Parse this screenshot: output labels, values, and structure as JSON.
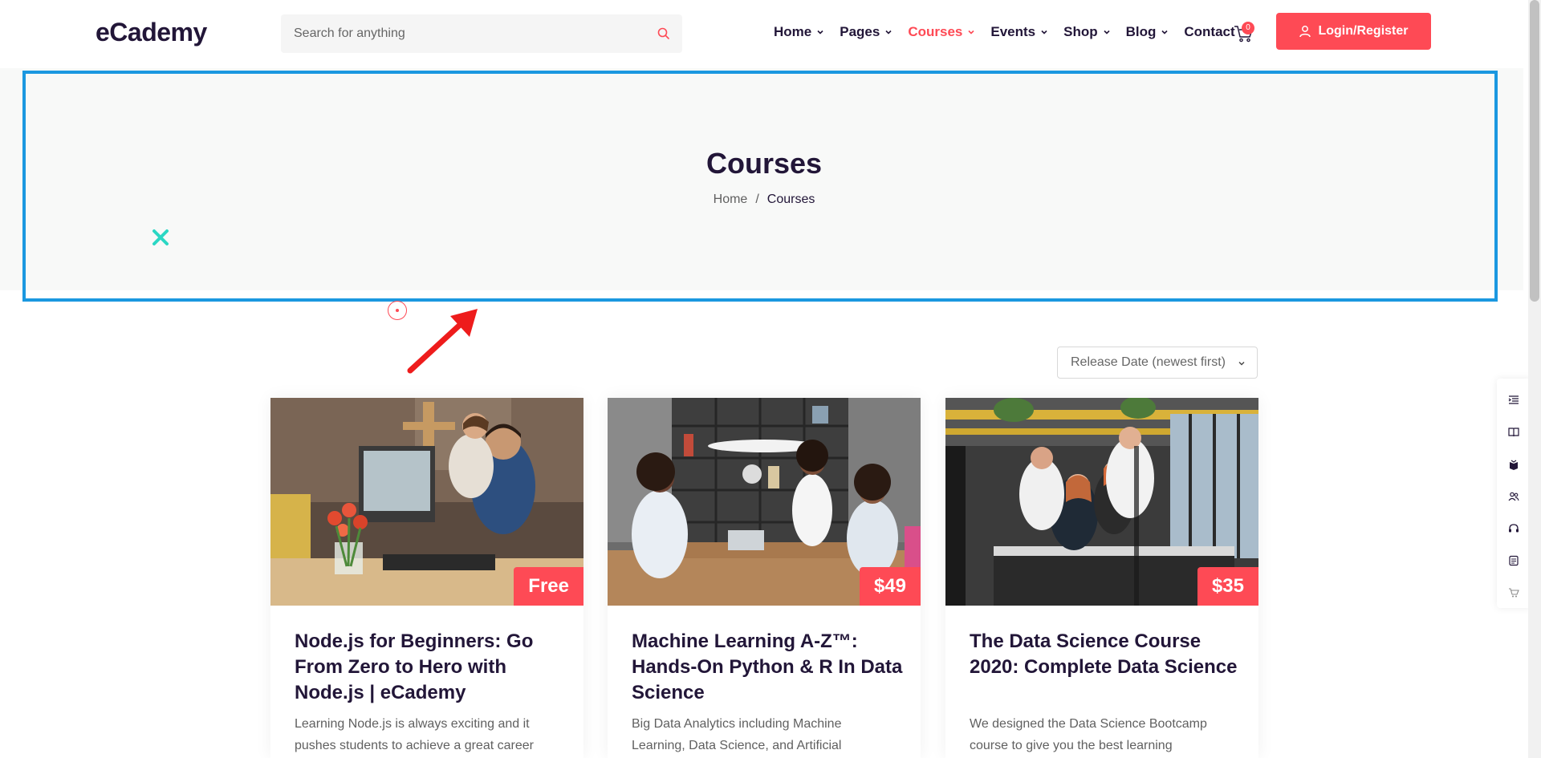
{
  "header": {
    "logo": "eCademy",
    "search_placeholder": "Search for anything",
    "nav": [
      {
        "label": "Home",
        "dropdown": true,
        "active": false
      },
      {
        "label": "Pages",
        "dropdown": true,
        "active": false
      },
      {
        "label": "Courses",
        "dropdown": true,
        "active": true
      },
      {
        "label": "Events",
        "dropdown": true,
        "active": false
      },
      {
        "label": "Shop",
        "dropdown": true,
        "active": false
      },
      {
        "label": "Blog",
        "dropdown": true,
        "active": false
      },
      {
        "label": "Contact",
        "dropdown": false,
        "active": false
      }
    ],
    "cart_count": "0",
    "login_label": "Login/Register"
  },
  "page_title": {
    "title": "Courses",
    "breadcrumb_home": "Home",
    "breadcrumb_sep": "/",
    "breadcrumb_current": "Courses"
  },
  "sort": {
    "selected": "Release Date (newest first)"
  },
  "courses": [
    {
      "price": "Free",
      "title": "Node.js for Beginners: Go From Zero to Hero with Node.js | eCademy",
      "description": "Learning Node.js is always exciting and it pushes students to achieve a great career"
    },
    {
      "price": "$49",
      "title": "Machine Learning A-Z™: Hands-On Python & R In Data Science",
      "description": "Big Data Analytics including Machine Learning, Data Science, and Artificial"
    },
    {
      "price": "$35",
      "title": "The Data Science Course 2020: Complete Data Science",
      "description": "We designed the Data Science Bootcamp course to give you the best learning"
    }
  ],
  "dock_icons": [
    "menu-list-icon",
    "book-open-icon",
    "book-icon",
    "users-icon",
    "headset-icon",
    "blog-icon",
    "cart-icon"
  ],
  "colors": {
    "accent": "#fe4a55",
    "dark": "#221638",
    "highlight": "#1b98e0",
    "shape_teal": "#2bd7c4"
  }
}
